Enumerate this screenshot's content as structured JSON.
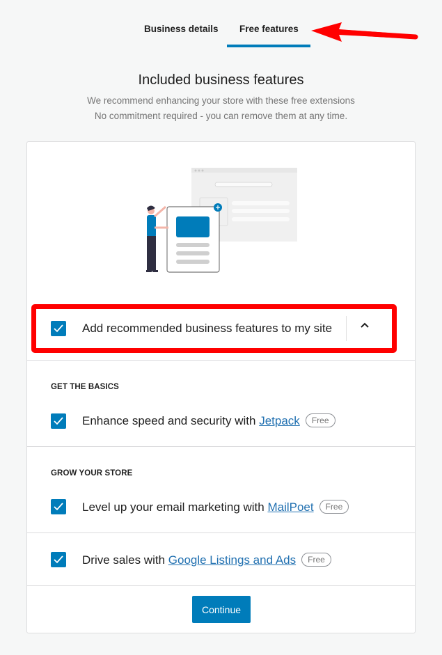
{
  "tabs": [
    {
      "label": "Business details",
      "active": false
    },
    {
      "label": "Free features",
      "active": true
    }
  ],
  "header": {
    "title": "Included business features",
    "subtitle_line1": "We recommend enhancing your store with these free extensions",
    "subtitle_line2": "No commitment required - you can remove them at any time."
  },
  "main_option": {
    "label": "Add recommended business features to my site",
    "checked": true,
    "expanded": true
  },
  "sections": [
    {
      "title": "GET THE BASICS",
      "items": [
        {
          "prefix": "Enhance speed and security with ",
          "link": "Jetpack",
          "badge": "Free",
          "checked": true
        }
      ]
    },
    {
      "title": "GROW YOUR STORE",
      "items": [
        {
          "prefix": "Level up your email marketing with ",
          "link": "MailPoet",
          "badge": "Free",
          "checked": true
        },
        {
          "prefix": "Drive sales with ",
          "link": "Google Listings and Ads",
          "badge": "Free",
          "checked": true
        }
      ]
    }
  ],
  "footer": {
    "continue_label": "Continue"
  },
  "colors": {
    "accent": "#007cba",
    "annotation": "#ff0000",
    "link": "#2271b1"
  }
}
